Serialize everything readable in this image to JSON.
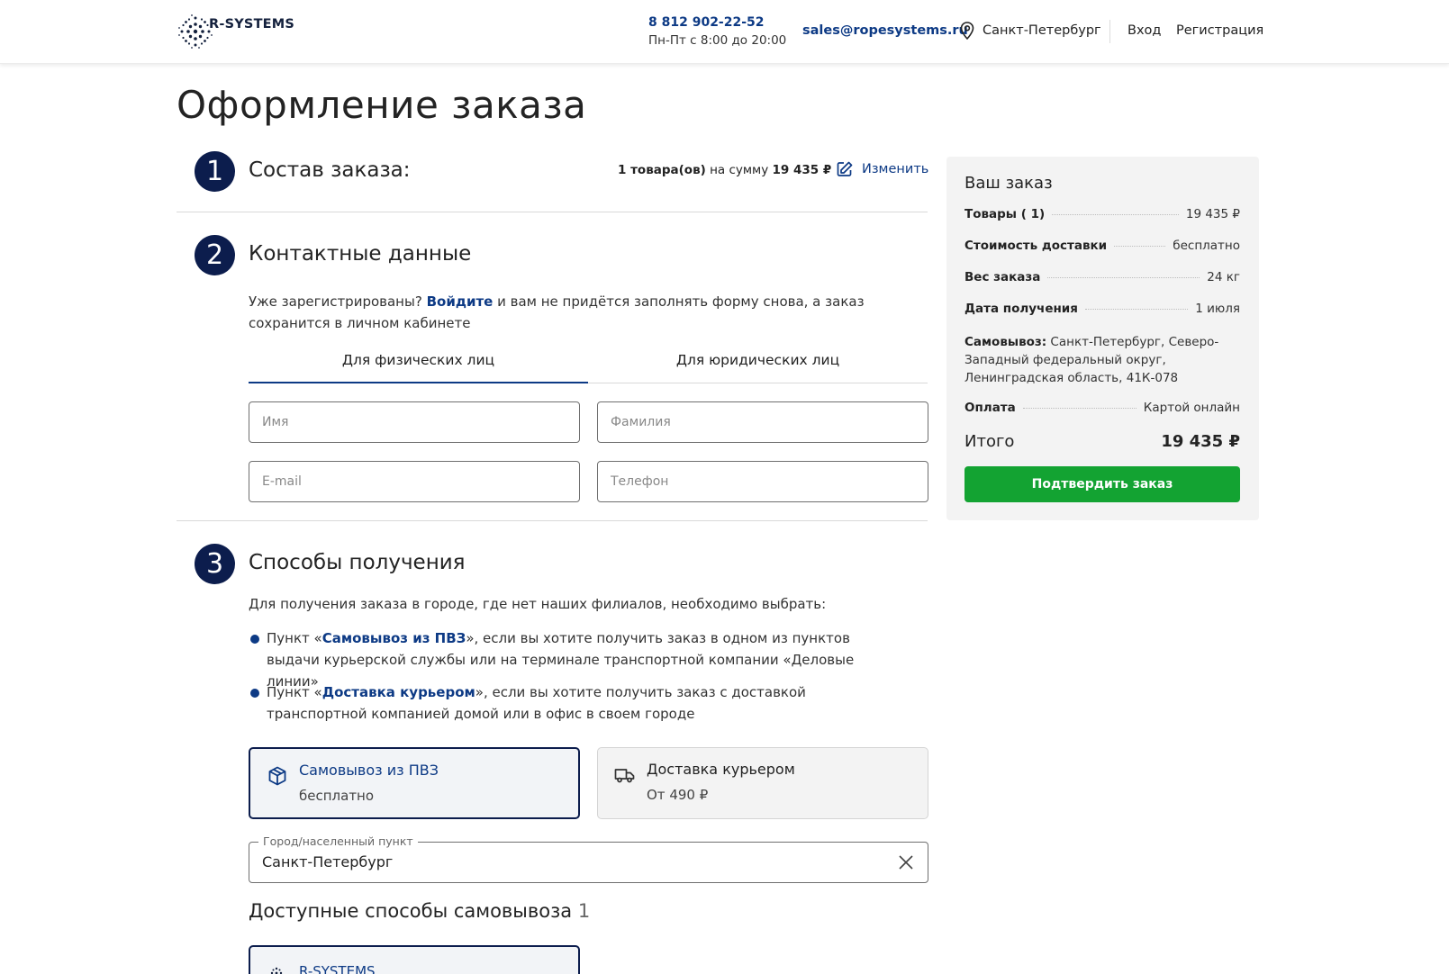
{
  "header": {
    "logo_text": "R-SYSTEMS",
    "phone": "8 812 902-22-52",
    "hours": "Пн-Пт с 8:00 до 20:00",
    "email": "sales@ropesystems.ru",
    "city": "Санкт-Петербург",
    "login": "Вход",
    "register": "Регистрация"
  },
  "page": {
    "title": "Оформление заказа"
  },
  "step1": {
    "number": "1",
    "title": "Состав заказа:",
    "items_count": "1 товара(ов)",
    "sum_label": " на сумму ",
    "sum_value": "19 435 ₽",
    "edit": "Изменить"
  },
  "step2": {
    "number": "2",
    "title": "Контактные данные",
    "hint_prefix": "Уже зарегистрированы? ",
    "hint_link": "Войдите",
    "hint_suffix": " и вам не придётся заполнять форму снова, а заказ сохранится в личном кабинете",
    "tabs": [
      {
        "label": "Для физических лиц",
        "active": true
      },
      {
        "label": "Для юридических лиц",
        "active": false
      }
    ],
    "fields": {
      "first_name": "Имя",
      "last_name": "Фамилия",
      "email": "E-mail",
      "phone": "Телефон"
    }
  },
  "step3": {
    "number": "3",
    "title": "Способы получения",
    "info": "Для получения заказа в городе, где нет наших филиалов, необходимо выбрать:",
    "bullets": [
      {
        "prefix": "Пункт «",
        "link": "Самовывоз из ПВЗ",
        "suffix": "», если вы хотите получить заказ в одном из пунктов выдачи курьерской службы или на терминале транспортной компании «Деловые линии»"
      },
      {
        "prefix": "Пункт «",
        "link": "Доставка курьером",
        "suffix": "», если вы хотите получить заказ с доставкой транспортной компанией домой или в офис в своем городе"
      }
    ],
    "options": [
      {
        "title": "Самовывоз из ПВЗ",
        "price": "бесплатно",
        "icon": "package-icon",
        "selected": true
      },
      {
        "title": "Доставка курьером",
        "price": "От 490 ₽",
        "icon": "truck-icon",
        "selected": false
      }
    ],
    "city_field": {
      "label": "Город/населенный пункт",
      "value": "Санкт-Петербург"
    },
    "available_title": "Доступные способы самовывоза",
    "available_count": "1",
    "pickup_card_title": "R-SYSTEMS"
  },
  "order": {
    "title": "Ваш заказ",
    "rows": [
      {
        "key": "Товары ( 1)",
        "value": "19 435 ₽"
      },
      {
        "key": "Стоимость доставки",
        "value": "бесплатно"
      },
      {
        "key": "Вес заказа",
        "value": "24 кг"
      },
      {
        "key": "Дата получения",
        "value": "1 июля"
      }
    ],
    "pickup_label": "Самовывоз:",
    "pickup_address": " Санкт-Петербург, Северо-Западный федеральный округ, Ленинградская область, 41К-078",
    "payment_key": "Оплата",
    "payment_value": "Картой онлайн",
    "total_label": "Итого",
    "total_value": "19 435 ₽",
    "confirm": "Подтвердить заказ"
  },
  "colors": {
    "brand_navy": "#0c1d4d",
    "link_blue": "#0d3a85",
    "confirm_green": "#13a332"
  }
}
